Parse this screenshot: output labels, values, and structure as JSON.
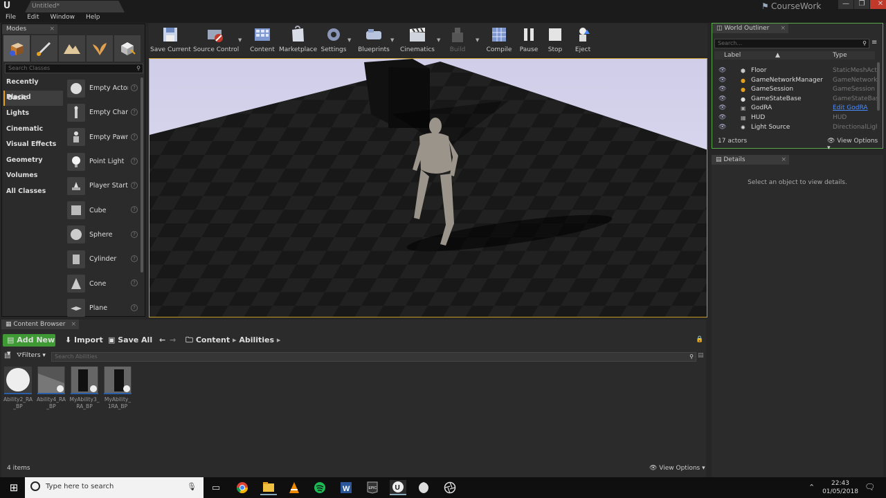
{
  "window": {
    "tab_title": "Untitled*",
    "project_name": "CourseWork",
    "minimize": "—",
    "maximize": "❐",
    "close": "✕"
  },
  "menu": [
    "File",
    "Edit",
    "Window",
    "Help"
  ],
  "modes": {
    "tab_label": "Modes",
    "search_placeholder": "Search Classes",
    "categories": [
      "Recently Placed",
      "Basic",
      "Lights",
      "Cinematic",
      "Visual Effects",
      "Geometry",
      "Volumes",
      "All Classes"
    ],
    "selected_category": "Basic",
    "items": [
      "Empty Actor",
      "Empty Chara",
      "Empty Pawn",
      "Point Light",
      "Player Start",
      "Cube",
      "Sphere",
      "Cylinder",
      "Cone",
      "Plane"
    ]
  },
  "toolbar": {
    "save_current": "Save Current",
    "source_control": "Source Control",
    "content": "Content",
    "marketplace": "Marketplace",
    "settings": "Settings",
    "blueprints": "Blueprints",
    "cinematics": "Cinematics",
    "build": "Build",
    "compile": "Compile",
    "pause": "Pause",
    "stop": "Stop",
    "eject": "Eject"
  },
  "world_outliner": {
    "tab_label": "World Outliner",
    "search_placeholder": "Search...",
    "col_label": "Label",
    "col_type": "Type",
    "rows": [
      {
        "label": "Floor",
        "type": "StaticMeshActo",
        "link": false
      },
      {
        "label": "GameNetworkManager",
        "type": "GameNetworkM",
        "link": false
      },
      {
        "label": "GameSession",
        "type": "GameSession",
        "link": false
      },
      {
        "label": "GameStateBase",
        "type": "GameStateBase",
        "link": false
      },
      {
        "label": "GodRA",
        "type": "Edit GodRA",
        "link": true
      },
      {
        "label": "HUD",
        "type": "HUD",
        "link": false
      },
      {
        "label": "Light Source",
        "type": "DirectionalLigh",
        "link": false
      }
    ],
    "actor_count": "17 actors",
    "view_options": "View Options"
  },
  "details": {
    "tab_label": "Details",
    "empty_message": "Select an object to view details."
  },
  "content_browser": {
    "tab_label": "Content Browser",
    "add_new": "Add New",
    "import": "Import",
    "save_all": "Save All",
    "path": [
      "Content",
      "Abilities"
    ],
    "filters": "Filters",
    "search_placeholder": "Search Abilities",
    "assets": [
      "Ability2_RA\n_BP",
      "Ability4_RA\n_BP",
      "MyAbility3_\nRA_BP",
      "MyAbility_\n1RA_BP"
    ],
    "item_count": "4 items",
    "view_options": "View Options"
  },
  "taskbar": {
    "search_placeholder": "Type here to search",
    "time": "22:43",
    "date": "01/05/2018"
  },
  "colors": {
    "selection_accent": "#e8a018",
    "add_new_green": "#3f9a35",
    "outliner_border": "#58a94a",
    "viewport_border": "#c49a22",
    "link_blue": "#4a8cff"
  }
}
